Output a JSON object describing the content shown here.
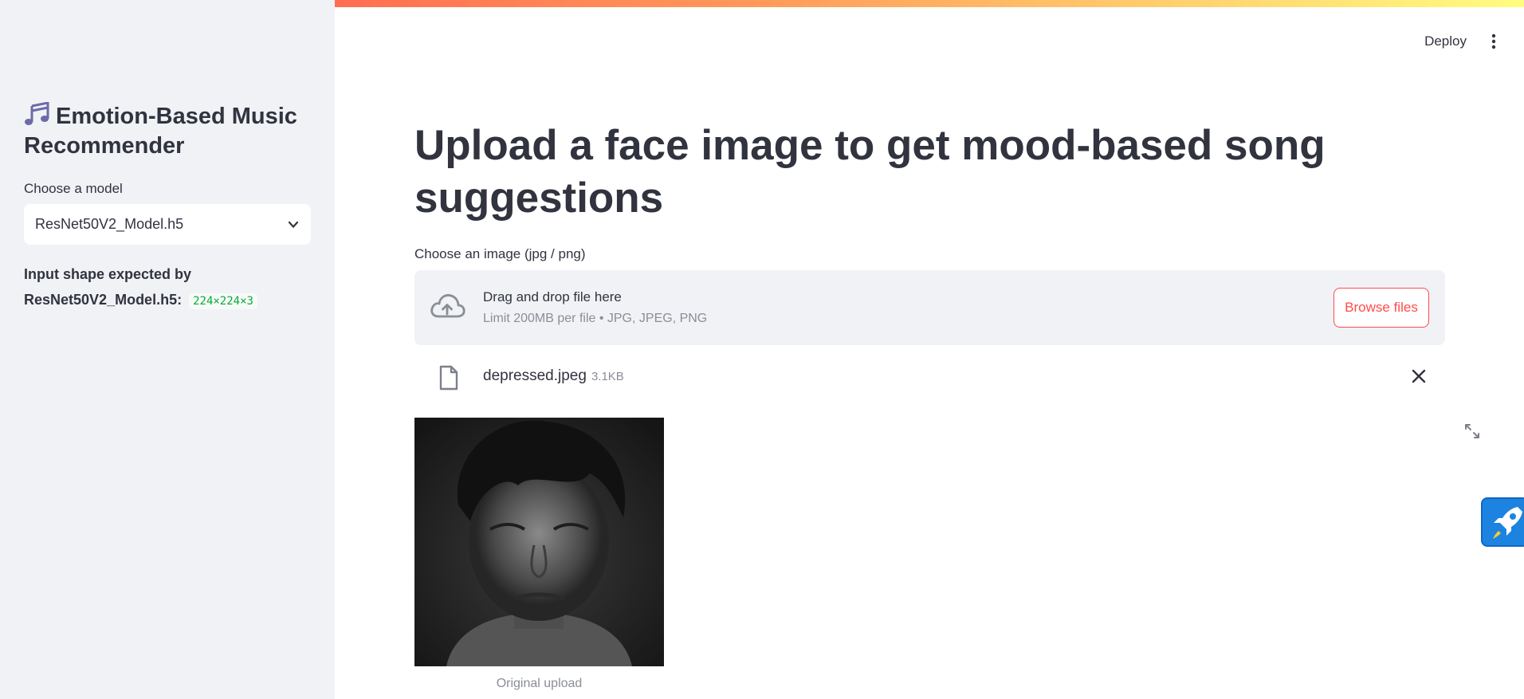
{
  "sidebar": {
    "app_title": "Emotion-Based Music Recommender",
    "model_label": "Choose a model",
    "model_selected": "ResNet50V2_Model.h5",
    "shape_label": "Input shape expected by ResNet50V2_Model.h5:",
    "shape_value": "224×224×3"
  },
  "header": {
    "deploy_label": "Deploy"
  },
  "main": {
    "title": "Upload a face image to get mood-based song suggestions",
    "uploader": {
      "label": "Choose an image (jpg / png)",
      "drag_text": "Drag and drop file here",
      "limit_text": "Limit 200MB per file • JPG, JPEG, PNG",
      "browse_label": "Browse files"
    },
    "file": {
      "name": "depressed.jpeg",
      "size": "3.1KB"
    },
    "image_caption": "Original upload"
  },
  "colors": {
    "accent": "#ff4b4b",
    "sidebar_bg": "#f0f2f6",
    "code_green": "#09ab3b",
    "rocket_blue": "#1c83e1"
  },
  "icons": [
    "music-note-icon",
    "chevron-down-icon",
    "kebab-menu-icon",
    "cloud-upload-icon",
    "file-icon",
    "close-icon",
    "expand-icon",
    "rocket-icon"
  ]
}
